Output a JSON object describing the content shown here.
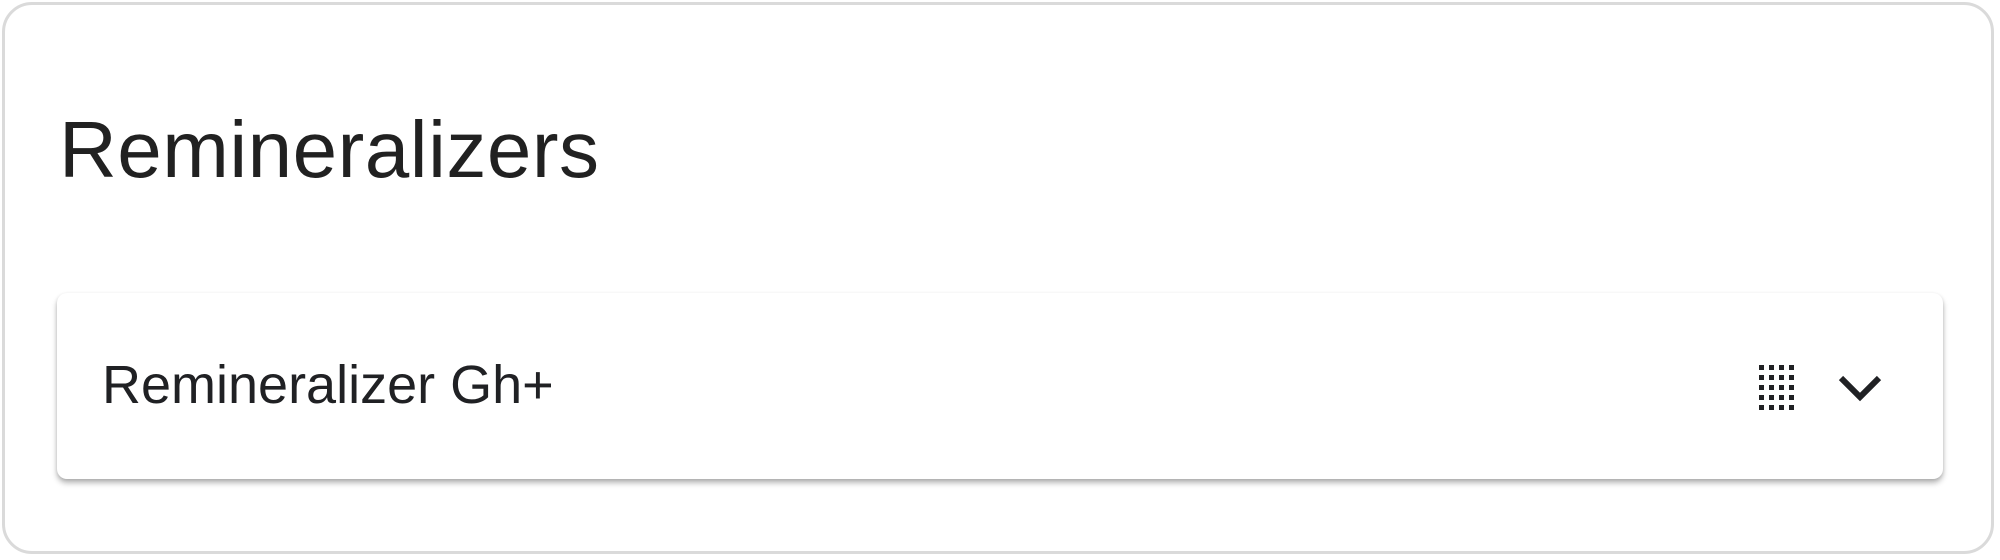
{
  "section": {
    "title": "Remineralizers"
  },
  "items": [
    {
      "label": "Remineralizer Gh+",
      "icons": {
        "drag": "drag-handle-icon",
        "expand": "chevron-down-icon"
      }
    }
  ]
}
